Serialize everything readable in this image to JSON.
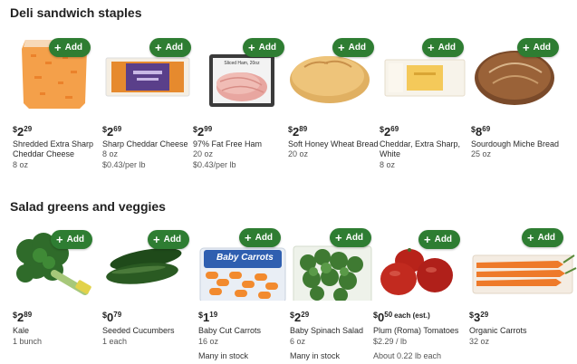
{
  "sections": [
    {
      "title": "Deli sandwich staples"
    },
    {
      "title": "Salad greens and veggies"
    }
  ],
  "add_label": "Add",
  "products": [
    {
      "price_whole": "2",
      "price_cents": "29",
      "name1": "Shredded Extra Sharp",
      "name2": "Cheddar Cheese",
      "sub1": "8 oz"
    },
    {
      "price_whole": "2",
      "price_cents": "69",
      "name1": "Sharp Cheddar Cheese",
      "sub1": "8 oz",
      "sub2": "$0.43/per lb"
    },
    {
      "price_whole": "2",
      "price_cents": "99",
      "name1": "97% Fat Free Ham",
      "sub1": "20 oz",
      "sub2": "$0.43/per lb",
      "package_label": "Sliced Ham, 20oz"
    },
    {
      "price_whole": "2",
      "price_cents": "89",
      "name1": "Soft Honey Wheat Bread",
      "sub1": "20 oz"
    },
    {
      "price_whole": "2",
      "price_cents": "69",
      "name1": "Cheddar, Extra Sharp,",
      "name2": "White",
      "sub1": "8 oz"
    },
    {
      "price_whole": "8",
      "price_cents": "69",
      "name1": "Sourdough Miche Bread",
      "sub1": "25 oz"
    },
    {
      "price_whole": "2",
      "price_cents": "89",
      "name1": "Kale",
      "sub1": "1 bunch"
    },
    {
      "price_whole": "0",
      "price_cents": "79",
      "name1": "Seeded Cucumbers",
      "sub1": "1 each"
    },
    {
      "price_whole": "1",
      "price_cents": "19",
      "name1": "Baby Cut Carrots",
      "sub1": "16 oz",
      "stock": "Many in stock",
      "package_label": "Baby Carrots"
    },
    {
      "price_whole": "2",
      "price_cents": "29",
      "name1": "Baby Spinach Salad",
      "sub1": "6 oz",
      "stock": "Many in stock"
    },
    {
      "price_whole": "0",
      "price_cents": "50",
      "price_suffix": "each (est.)",
      "name1": "Plum (Roma) Tomatoes",
      "sub1": "$2.29 / lb",
      "sub2": "About 0.22 lb each"
    },
    {
      "price_whole": "3",
      "price_cents": "29",
      "name1": "Organic Carrots",
      "sub1": "32 oz"
    }
  ],
  "colors": {
    "add_button": "#2e7d32",
    "text": "#1f1f1f"
  }
}
